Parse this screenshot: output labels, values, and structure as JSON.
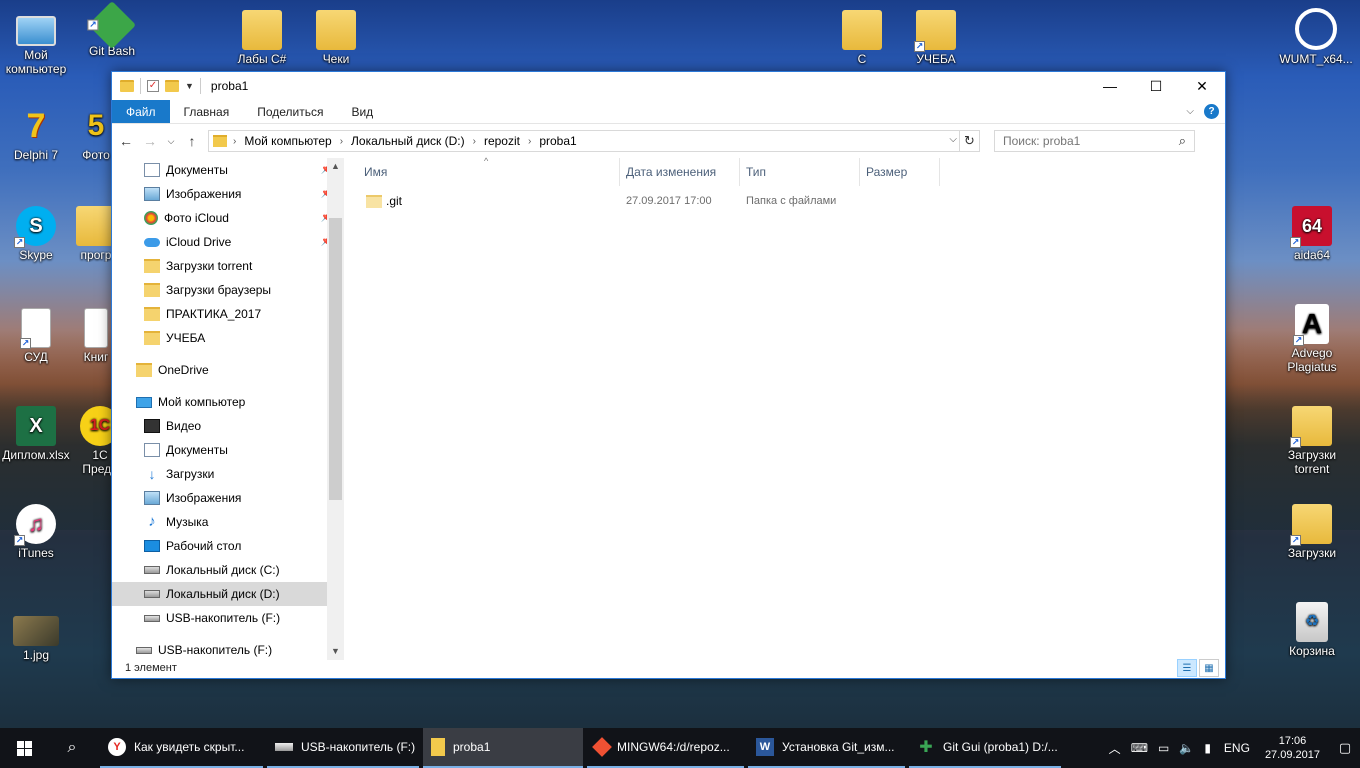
{
  "desktop": {
    "icons": [
      {
        "label": "Мой компьютер",
        "icon": "computer-icon"
      },
      {
        "label": "Git Bash",
        "icon": "git-icon"
      },
      {
        "label": "Лабы C#",
        "icon": "folder-icon"
      },
      {
        "label": "Чеки",
        "icon": "folder-icon"
      },
      {
        "label": "C",
        "icon": "folder-icon"
      },
      {
        "label": "УЧЕБА",
        "icon": "folder-icon"
      },
      {
        "label": "WUMT_x64...",
        "icon": "update-icon"
      },
      {
        "label": "Delphi 7",
        "icon": "delphi-icon"
      },
      {
        "label": "Фото",
        "icon": "app-icon"
      },
      {
        "label": "Skype",
        "icon": "skype-icon"
      },
      {
        "label": "прогр",
        "icon": "folder-icon"
      },
      {
        "label": "aida64",
        "icon": "aida-icon"
      },
      {
        "label": "СУД",
        "icon": "document-icon"
      },
      {
        "label": "Книг",
        "icon": "document-icon"
      },
      {
        "label": "Advego Plagiatus",
        "icon": "advego-icon"
      },
      {
        "label": "Диплом.xlsx",
        "icon": "excel-icon"
      },
      {
        "label": "1С Предп",
        "icon": "onec-icon"
      },
      {
        "label": "Загрузки torrent",
        "icon": "folder-icon"
      },
      {
        "label": "iTunes",
        "icon": "itunes-icon"
      },
      {
        "label": "Загрузки",
        "icon": "folder-icon"
      },
      {
        "label": "1.jpg",
        "icon": "image-icon"
      },
      {
        "label": "Корзина",
        "icon": "recycle-bin-icon"
      }
    ]
  },
  "window": {
    "title": "proba1",
    "ribbon_tabs": [
      "Файл",
      "Главная",
      "Поделиться",
      "Вид"
    ],
    "breadcrumb": [
      "Мой компьютер",
      "Локальный диск (D:)",
      "repozit",
      "proba1"
    ],
    "search_placeholder": "Поиск: proba1",
    "nav_items": [
      {
        "label": "Документы",
        "icon": "documents-icon",
        "pinned": true
      },
      {
        "label": "Изображения",
        "icon": "pictures-icon",
        "pinned": true
      },
      {
        "label": "Фото iCloud",
        "icon": "icloud-photos-icon",
        "pinned": true
      },
      {
        "label": "iCloud Drive",
        "icon": "icloud-drive-icon",
        "pinned": true
      },
      {
        "label": "Загрузки torrent",
        "icon": "folder-icon"
      },
      {
        "label": "Загрузки браузеры",
        "icon": "folder-icon"
      },
      {
        "label": "ПРАКТИКА_2017",
        "icon": "folder-icon"
      },
      {
        "label": "УЧЕБА",
        "icon": "folder-icon"
      },
      {
        "label": "OneDrive",
        "icon": "onedrive-icon"
      },
      {
        "label": "Мой компьютер",
        "icon": "computer-icon"
      },
      {
        "label": "Видео",
        "icon": "video-icon"
      },
      {
        "label": "Документы",
        "icon": "documents-icon"
      },
      {
        "label": "Загрузки",
        "icon": "downloads-icon"
      },
      {
        "label": "Изображения",
        "icon": "pictures-icon"
      },
      {
        "label": "Музыка",
        "icon": "music-icon"
      },
      {
        "label": "Рабочий стол",
        "icon": "desktop-icon"
      },
      {
        "label": "Локальный диск (C:)",
        "icon": "drive-icon"
      },
      {
        "label": "Локальный диск (D:)",
        "icon": "drive-icon",
        "selected": true
      },
      {
        "label": "USB-накопитель (F:)",
        "icon": "usb-drive-icon"
      },
      {
        "label": "USB-накопитель (F:)",
        "icon": "usb-drive-icon"
      }
    ],
    "columns": [
      "Имя",
      "Дата изменения",
      "Тип",
      "Размер"
    ],
    "files": [
      {
        "name": ".git",
        "modified": "27.09.2017 17:00",
        "type": "Папка с файлами",
        "size": ""
      }
    ],
    "status": "1 элемент"
  },
  "taskbar": {
    "buttons": [
      {
        "label": "Как увидеть скрыт...",
        "icon": "yandex-browser-icon",
        "color": "#e52620"
      },
      {
        "label": "USB-накопитель (F:)",
        "icon": "usb-drive-icon",
        "color": "#cccccc"
      },
      {
        "label": "proba1",
        "icon": "folder-icon",
        "color": "#f2c94c"
      },
      {
        "label": "MINGW64:/d/repoz...",
        "icon": "git-icon",
        "color": "#f05133"
      },
      {
        "label": "Установка Git_изм...",
        "icon": "word-icon",
        "color": "#2b579a"
      },
      {
        "label": "Git Gui (proba1) D:/...",
        "icon": "git-gui-icon",
        "color": "#3aa655"
      }
    ],
    "tray": {
      "lang": "ENG",
      "time": "17:06",
      "date": "27.09.2017"
    }
  }
}
